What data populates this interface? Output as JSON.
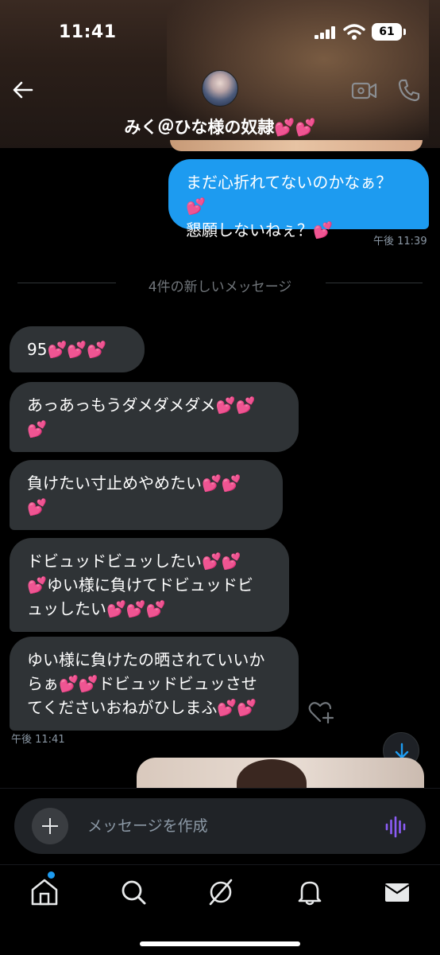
{
  "status_bar": {
    "time": "11:41",
    "battery": "61"
  },
  "header": {
    "contact_name": "みく＠ひな様の奴隷💕💕"
  },
  "messages": {
    "sent": [
      {
        "lines": [
          "まだ心折れてないのかなぁ？💕",
          "懇願しないねぇ？💕"
        ],
        "time": "午後 11:39"
      }
    ],
    "divider": "4件の新しいメッセージ",
    "received": [
      {
        "lines": [
          "95💕💕💕"
        ]
      },
      {
        "lines": [
          "あっあっもうダメダメダメ💕💕",
          "💕"
        ]
      },
      {
        "lines": [
          "負けたい寸止めやめたい💕💕",
          "💕"
        ]
      },
      {
        "lines": [
          "ドビュッドビュッしたい💕💕",
          "💕ゆい様に負けてドビュッドビ",
          "ュッしたい💕💕💕"
        ]
      },
      {
        "lines": [
          "ゆい様に負けたの晒されていいか",
          "らぁ💕💕ドビュッドビュッさせ",
          "てくださいおねがひしまふ💕💕"
        ]
      }
    ],
    "received_time": "午後 11:41"
  },
  "composer": {
    "placeholder": "メッセージを作成"
  },
  "bottom_nav": {
    "items": [
      "home",
      "search",
      "grok",
      "notifications",
      "messages"
    ],
    "icons": [
      "home-icon",
      "search-icon",
      "grok-icon",
      "bell-icon",
      "mail-icon"
    ],
    "home_has_new": true
  },
  "colors": {
    "accent": "#1d9bf0",
    "bubble_received": "#2f3336",
    "background": "#000000",
    "voice": "#8b5cf6"
  }
}
